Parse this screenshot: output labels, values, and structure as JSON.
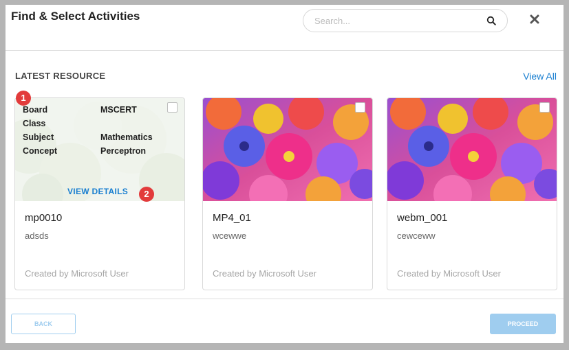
{
  "dialog": {
    "title": "Find & Select Activities",
    "search_placeholder": "Search...",
    "search_icon": "search-icon",
    "close_icon": "close-icon"
  },
  "section": {
    "title": "LATEST RESOURCE",
    "view_all": "View All"
  },
  "cards": [
    {
      "name": "mp0010",
      "description": "adsds",
      "author": "Created by Microsoft User",
      "meta": [
        {
          "label": "Board",
          "value": "MSCERT"
        },
        {
          "label": "Class",
          "value": ""
        },
        {
          "label": "Subject",
          "value": "Mathematics"
        },
        {
          "label": "Concept",
          "value": "Perceptron"
        }
      ],
      "view_details": "VIEW DETAILS",
      "badges": [
        "1",
        "2"
      ]
    },
    {
      "name": "MP4_01",
      "description": "wcewwe",
      "author": "Created by Microsoft User"
    },
    {
      "name": "webm_001",
      "description": "cewceww",
      "author": "Created by Microsoft User"
    }
  ],
  "footer": {
    "back": "BACK",
    "proceed": "PROCEED"
  },
  "colors": {
    "accent": "#1a7fd0",
    "button_disabled": "#9fcdef",
    "badge": "#e23b3b"
  }
}
